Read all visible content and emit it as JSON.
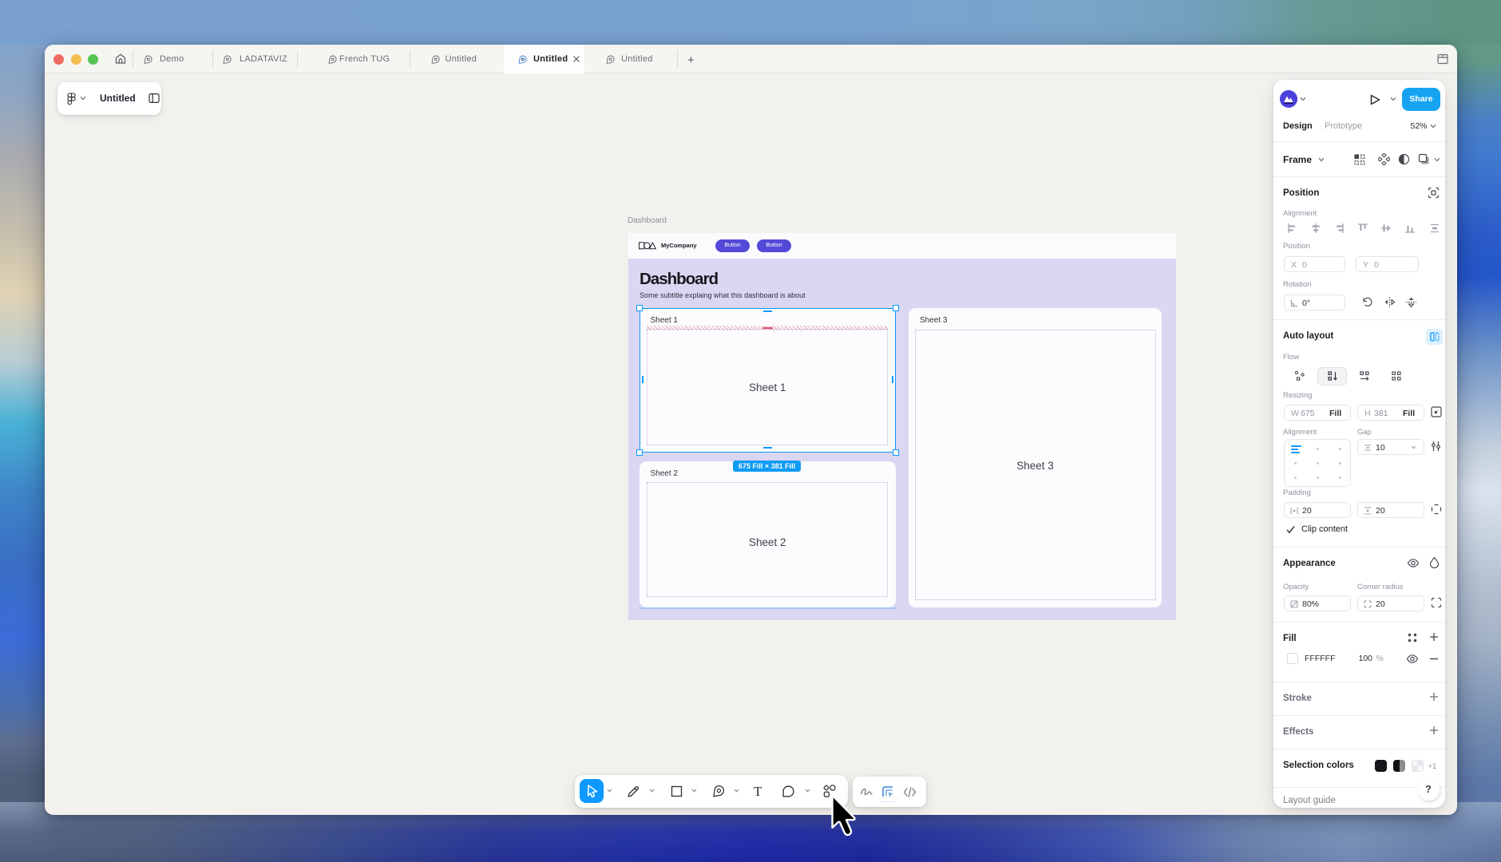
{
  "window": {
    "tabs": [
      {
        "label": "Demo"
      },
      {
        "label": "LADATAVIZ"
      },
      {
        "label": "French TUG"
      },
      {
        "label": "Untitled"
      },
      {
        "label": "Untitled",
        "active": true
      },
      {
        "label": "Untitled"
      }
    ],
    "new_tab_label": "+"
  },
  "file_chip": {
    "title": "Untitled"
  },
  "canvas": {
    "frame_label": "Dashboard",
    "header": {
      "logo_text": "MyCompany",
      "buttons": [
        "Button",
        "Button"
      ]
    },
    "title": "Dashboard",
    "subtitle": "Some subtitle explaing what this dashboard is about",
    "sheets": [
      {
        "label": "Sheet 1",
        "center_text": "Sheet 1"
      },
      {
        "label": "Sheet 2",
        "center_text": "Sheet 2"
      },
      {
        "label": "Sheet 3",
        "center_text": "Sheet 3"
      }
    ],
    "selection_size_label": "675 Fill × 381 Fill"
  },
  "panel": {
    "share_label": "Share",
    "tabs": {
      "design": "Design",
      "prototype": "Prototype"
    },
    "zoom": "52%",
    "frame_row": {
      "label": "Frame"
    },
    "position": {
      "title": "Position",
      "alignment_label": "Alignment",
      "position_label": "Position",
      "x_label": "X",
      "x_value": "0",
      "y_label": "Y",
      "y_value": "0",
      "rotation_label": "Rotation",
      "rotation_value": "0°"
    },
    "auto_layout": {
      "title": "Auto layout",
      "flow_label": "Flow",
      "resizing_label": "Resizing",
      "w_label": "W",
      "w_value": "675",
      "w_mode": "Fill",
      "h_label": "H",
      "h_value": "381",
      "h_mode": "Fill",
      "alignment_label": "Alignment",
      "gap_label": "Gap",
      "gap_value": "10",
      "padding_label": "Padding",
      "padding_h": "20",
      "padding_v": "20",
      "clip_content": "Clip content"
    },
    "appearance": {
      "title": "Appearance",
      "opacity_label": "Opacity",
      "opacity_value": "80%",
      "radius_label": "Corner radius",
      "radius_value": "20"
    },
    "fill": {
      "title": "Fill",
      "hex": "FFFFFF",
      "opacity": "100",
      "percent": "%"
    },
    "stroke": {
      "title": "Stroke"
    },
    "effects": {
      "title": "Effects"
    },
    "selection_colors": {
      "title": "Selection colors",
      "more": "+1"
    },
    "layout_guide": {
      "title": "Layout guide"
    },
    "help": "?"
  },
  "colors": {
    "accent_blue": "#0d99ff",
    "share_blue": "#16a4f1",
    "button_purple": "#5349d8",
    "frame_body": "#dad7f2",
    "avatar_purple": "#4b41db"
  }
}
